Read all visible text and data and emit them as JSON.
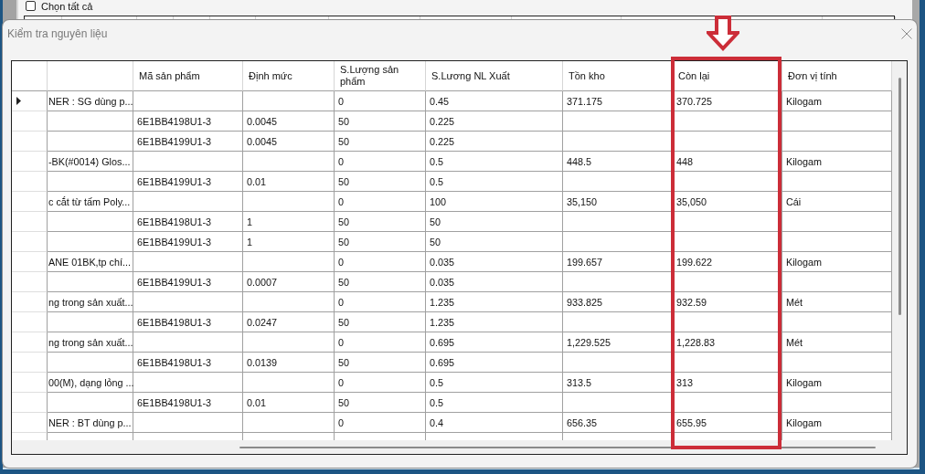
{
  "background_window": {
    "select_all": {
      "label": "Chọn tất cả",
      "checked": false
    }
  },
  "dialog": {
    "title": "Kiểm tra nguyên liệu"
  },
  "table": {
    "columns": [
      {
        "label": "Mã sản phẩm",
        "highlighted": false
      },
      {
        "label": "Định mức",
        "highlighted": false
      },
      {
        "label": "S.Lượng sản phẩm",
        "highlighted": false
      },
      {
        "label": "S.Lương NL Xuất",
        "highlighted": false
      },
      {
        "label": "Tồn kho",
        "highlighted": false
      },
      {
        "label": "Còn lại",
        "highlighted": true
      },
      {
        "label": "Đơn vị tính",
        "highlighted": false
      }
    ],
    "rows": [
      {
        "selected": true,
        "column_1": "NER : SG dùng p...",
        "sl_san_pham": "0",
        "sl_nl_xuat": "0.45",
        "ton_kho": "371.175",
        "con_lai": "370.725",
        "don_vi_tinh": "Kilogam"
      },
      {
        "selected": false,
        "ma_san_pham": "6E1BB4198U1-3",
        "dinh_muc": "0.0045",
        "sl_san_pham": "50",
        "sl_nl_xuat": "0.225"
      },
      {
        "selected": false,
        "ma_san_pham": "6E1BB4199U1-3",
        "dinh_muc": "0.0045",
        "sl_san_pham": "50",
        "sl_nl_xuat": "0.225"
      },
      {
        "selected": false,
        "column_1": "-BK(#0014) Glos...",
        "sl_san_pham": "0",
        "sl_nl_xuat": "0.5",
        "ton_kho": "448.5",
        "con_lai": "448",
        "don_vi_tinh": "Kilogam"
      },
      {
        "selected": false,
        "ma_san_pham": "6E1BB4199U1-3",
        "dinh_muc": "0.01",
        "sl_san_pham": "50",
        "sl_nl_xuat": "0.5"
      },
      {
        "selected": false,
        "column_1": "c cắt từ tấm Poly...",
        "sl_san_pham": "0",
        "sl_nl_xuat": "100",
        "ton_kho": "35,150",
        "con_lai": "35,050",
        "don_vi_tinh": "Cái"
      },
      {
        "selected": false,
        "ma_san_pham": "6E1BB4198U1-3",
        "dinh_muc": "1",
        "sl_san_pham": "50",
        "sl_nl_xuat": "50"
      },
      {
        "selected": false,
        "ma_san_pham": "6E1BB4199U1-3",
        "dinh_muc": "1",
        "sl_san_pham": "50",
        "sl_nl_xuat": "50"
      },
      {
        "selected": false,
        "column_1": "ANE 01BK,tp chí...",
        "sl_san_pham": "0",
        "sl_nl_xuat": "0.035",
        "ton_kho": "199.657",
        "con_lai": "199.622",
        "don_vi_tinh": "Kilogam"
      },
      {
        "selected": false,
        "ma_san_pham": "6E1BB4199U1-3",
        "dinh_muc": "0.0007",
        "sl_san_pham": "50",
        "sl_nl_xuat": "0.035"
      },
      {
        "selected": false,
        "column_1": "ng trong sản xuất...",
        "sl_san_pham": "0",
        "sl_nl_xuat": "1.235",
        "ton_kho": "933.825",
        "con_lai": "932.59",
        "don_vi_tinh": "Mét"
      },
      {
        "selected": false,
        "ma_san_pham": "6E1BB4198U1-3",
        "dinh_muc": "0.0247",
        "sl_san_pham": "50",
        "sl_nl_xuat": "1.235"
      },
      {
        "selected": false,
        "column_1": "ng trong sản xuất...",
        "sl_san_pham": "0",
        "sl_nl_xuat": "0.695",
        "ton_kho": "1,229.525",
        "con_lai": "1,228.83",
        "don_vi_tinh": "Mét"
      },
      {
        "selected": false,
        "ma_san_pham": "6E1BB4198U1-3",
        "dinh_muc": "0.0139",
        "sl_san_pham": "50",
        "sl_nl_xuat": "0.695"
      },
      {
        "selected": false,
        "column_1": "00(M), dạng lỏng ...",
        "sl_san_pham": "0",
        "sl_nl_xuat": "0.5",
        "ton_kho": "313.5",
        "con_lai": "313",
        "don_vi_tinh": "Kilogam"
      },
      {
        "selected": false,
        "ma_san_pham": "6E1BB4198U1-3",
        "dinh_muc": "0.01",
        "sl_san_pham": "50",
        "sl_nl_xuat": "0.5"
      },
      {
        "selected": false,
        "column_1": "NER : BT dùng p...",
        "sl_san_pham": "0",
        "sl_nl_xuat": "0.4",
        "ton_kho": "656.35",
        "con_lai": "655.95",
        "don_vi_tinh": "Kilogam"
      }
    ]
  }
}
